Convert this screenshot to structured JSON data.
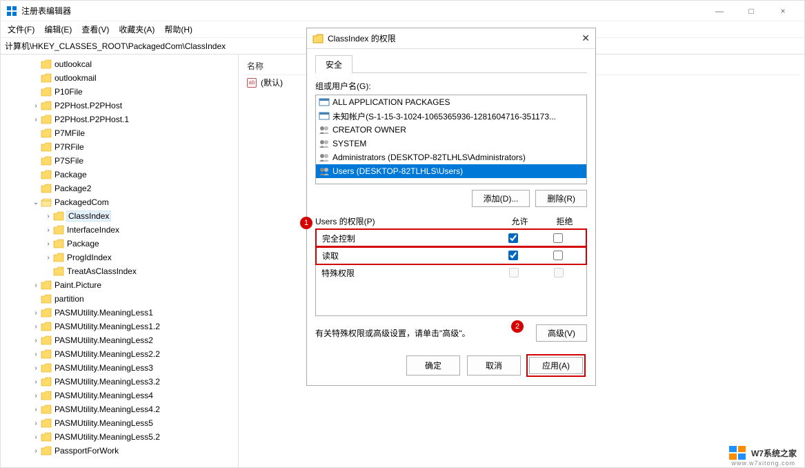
{
  "window": {
    "title": "注册表编辑器",
    "controls": {
      "min": "—",
      "max": "□",
      "close": "×"
    }
  },
  "menu": {
    "file": "文件(F)",
    "edit": "编辑(E)",
    "view": "查看(V)",
    "fav": "收藏夹(A)",
    "help": "帮助(H)"
  },
  "address": "计算机\\HKEY_CLASSES_ROOT\\PackagedCom\\ClassIndex",
  "tree": [
    {
      "label": "outlookcal",
      "indent": 2,
      "exp": ""
    },
    {
      "label": "outlookmail",
      "indent": 2,
      "exp": ""
    },
    {
      "label": "P10File",
      "indent": 2,
      "exp": ""
    },
    {
      "label": "P2PHost.P2PHost",
      "indent": 2,
      "exp": ">"
    },
    {
      "label": "P2PHost.P2PHost.1",
      "indent": 2,
      "exp": ">"
    },
    {
      "label": "P7MFile",
      "indent": 2,
      "exp": ""
    },
    {
      "label": "P7RFile",
      "indent": 2,
      "exp": ""
    },
    {
      "label": "P7SFile",
      "indent": 2,
      "exp": ""
    },
    {
      "label": "Package",
      "indent": 2,
      "exp": ""
    },
    {
      "label": "Package2",
      "indent": 2,
      "exp": ""
    },
    {
      "label": "PackagedCom",
      "indent": 2,
      "exp": "v",
      "open": true
    },
    {
      "label": "ClassIndex",
      "indent": 3,
      "exp": ">",
      "selected": true
    },
    {
      "label": "InterfaceIndex",
      "indent": 3,
      "exp": ">"
    },
    {
      "label": "Package",
      "indent": 3,
      "exp": ">"
    },
    {
      "label": "ProgIdIndex",
      "indent": 3,
      "exp": ">"
    },
    {
      "label": "TreatAsClassIndex",
      "indent": 3,
      "exp": ""
    },
    {
      "label": "Paint.Picture",
      "indent": 2,
      "exp": ">"
    },
    {
      "label": "partition",
      "indent": 2,
      "exp": ""
    },
    {
      "label": "PASMUtility.MeaningLess1",
      "indent": 2,
      "exp": ">"
    },
    {
      "label": "PASMUtility.MeaningLess1.2",
      "indent": 2,
      "exp": ">"
    },
    {
      "label": "PASMUtility.MeaningLess2",
      "indent": 2,
      "exp": ">"
    },
    {
      "label": "PASMUtility.MeaningLess2.2",
      "indent": 2,
      "exp": ">"
    },
    {
      "label": "PASMUtility.MeaningLess3",
      "indent": 2,
      "exp": ">"
    },
    {
      "label": "PASMUtility.MeaningLess3.2",
      "indent": 2,
      "exp": ">"
    },
    {
      "label": "PASMUtility.MeaningLess4",
      "indent": 2,
      "exp": ">"
    },
    {
      "label": "PASMUtility.MeaningLess4.2",
      "indent": 2,
      "exp": ">"
    },
    {
      "label": "PASMUtility.MeaningLess5",
      "indent": 2,
      "exp": ">"
    },
    {
      "label": "PASMUtility.MeaningLess5.2",
      "indent": 2,
      "exp": ">"
    },
    {
      "label": "PassportForWork",
      "indent": 2,
      "exp": ">"
    }
  ],
  "details": {
    "col_name": "名称",
    "row_name": "(默认)",
    "icon_text": "ab"
  },
  "dialog": {
    "title": "ClassIndex 的权限",
    "tab": "安全",
    "groups_label": "组或用户名(G):",
    "users": [
      {
        "name": "ALL APPLICATION PACKAGES",
        "icon": "pkg"
      },
      {
        "name": "未知帐户(S-1-15-3-1024-1065365936-1281604716-351173...",
        "icon": "pkg"
      },
      {
        "name": "CREATOR OWNER",
        "icon": "users"
      },
      {
        "name": "SYSTEM",
        "icon": "users"
      },
      {
        "name": "Administrators (DESKTOP-82TLHLS\\Administrators)",
        "icon": "users"
      },
      {
        "name": "Users (DESKTOP-82TLHLS\\Users)",
        "icon": "users",
        "selected": true
      }
    ],
    "add_btn": "添加(D)...",
    "remove_btn": "删除(R)",
    "perm_label": "Users 的权限(P)",
    "col_allow": "允许",
    "col_deny": "拒绝",
    "perms": [
      {
        "name": "完全控制",
        "allow": true,
        "deny": false,
        "highlight": true
      },
      {
        "name": "读取",
        "allow": true,
        "deny": false,
        "highlight": true
      },
      {
        "name": "特殊权限",
        "allow": false,
        "deny": false,
        "disabled": true
      }
    ],
    "hint": "有关特殊权限或高级设置，请单击\"高级\"。",
    "advanced_btn": "高级(V)",
    "ok_btn": "确定",
    "cancel_btn": "取消",
    "apply_btn": "应用(A)"
  },
  "callouts": {
    "c1": "1",
    "c2": "2"
  },
  "watermark": {
    "brand": "W7系统之家",
    "sub": "www.w7xitong.com",
    "w7": "W7"
  }
}
